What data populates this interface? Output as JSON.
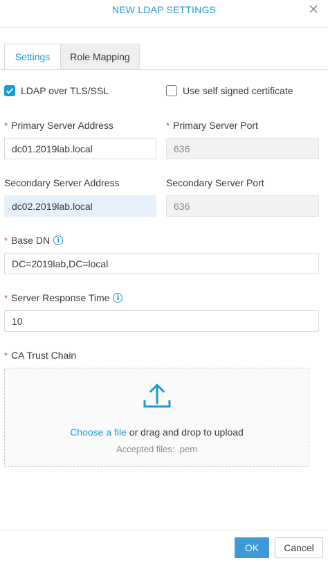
{
  "dialog": {
    "title": "NEW LDAP SETTINGS"
  },
  "tabs": [
    {
      "label": "Settings",
      "active": true
    },
    {
      "label": "Role Mapping",
      "active": false
    }
  ],
  "options": {
    "ldap_tls": {
      "label": "LDAP over TLS/SSL",
      "checked": true
    },
    "self_signed": {
      "label": "Use self signed certificate",
      "checked": false
    }
  },
  "fields": {
    "primary_address": {
      "label": "Primary Server Address",
      "required": true,
      "value": "dc01.2019lab.local"
    },
    "primary_port": {
      "label": "Primary Server Port",
      "required": true,
      "value": "636",
      "disabled": true
    },
    "secondary_address": {
      "label": "Secondary Server Address",
      "value": "dc02.2019lab.local"
    },
    "secondary_port": {
      "label": "Secondary Server Port",
      "value": "636",
      "disabled": true
    },
    "base_dn": {
      "label": "Base DN",
      "required": true,
      "value": "DC=2019lab,DC=local"
    },
    "response_time": {
      "label": "Server Response Time",
      "required": true,
      "value": "10"
    },
    "ca_chain": {
      "label": "CA Trust Chain",
      "required": true
    }
  },
  "upload": {
    "link_text": "Choose a file",
    "rest_text": "or drag and drop to upload",
    "accepted": "Accepted files: .pem"
  },
  "required_mark": "*",
  "info_glyph": "i",
  "buttons": {
    "ok": "OK",
    "cancel": "Cancel"
  },
  "colors": {
    "accent": "#1b9bd4",
    "required": "#d8373a",
    "ok_button": "#3d9ad7",
    "focused_input": "#e6f0fb"
  }
}
